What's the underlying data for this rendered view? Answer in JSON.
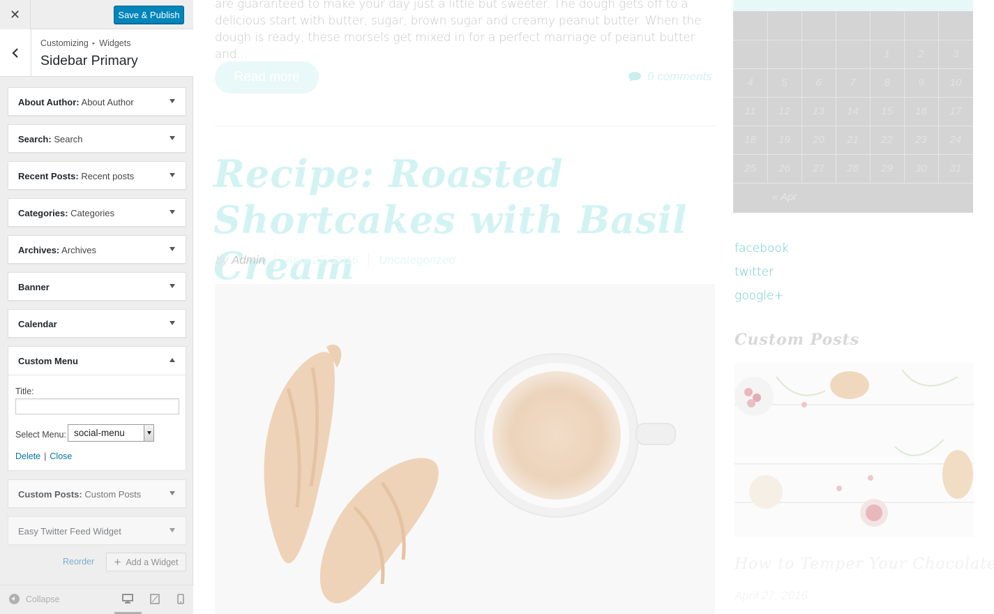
{
  "header": {
    "close_label": "✕",
    "publish_label": "Save & Publish"
  },
  "section": {
    "breadcrumb_root": "Customizing",
    "breadcrumb_sep": "▸",
    "breadcrumb_parent": "Widgets",
    "title": "Sidebar Primary"
  },
  "widgets": [
    {
      "type": "About Author",
      "title": "About Author"
    },
    {
      "type": "Search",
      "title": "Search"
    },
    {
      "type": "Recent Posts",
      "title": "Recent posts"
    },
    {
      "type": "Categories",
      "title": "Categories"
    },
    {
      "type": "Archives",
      "title": "Archives"
    },
    {
      "type": "Banner",
      "title": ""
    },
    {
      "type": "Calendar",
      "title": ""
    }
  ],
  "custom_menu": {
    "type": "Custom Menu",
    "title_label": "Title:",
    "title_value": "",
    "select_label": "Select Menu:",
    "select_value": "social-menu",
    "delete_label": "Delete",
    "link_sep": "|",
    "close_label": "Close"
  },
  "widgets_after": [
    {
      "type": "Custom Posts",
      "title": "Custom Posts"
    },
    {
      "type": "Easy Twitter Feed Widget",
      "title": ""
    }
  ],
  "panel_actions": {
    "reorder_label": "Reorder",
    "add_widget_label": "Add a Widget",
    "add_widget_icon": "plus-icon"
  },
  "footer": {
    "collapse_label": "Collapse",
    "devices": [
      "desktop-icon",
      "tablet-icon",
      "mobile-icon"
    ]
  },
  "preview": {
    "excerpt": "are guaranteed to make your day just a little but sweeter. The dough gets off to a delicious start with butter, sugar, brown sugar and creamy peanut butter. When the dough is ready, these morsels get mixed in for a perfect marriage of peanut butter and...",
    "read_more": "Read more",
    "comments": "0 comments",
    "post_title": "Recipe: Roasted Shortcakes with Basil Cream",
    "meta_by": "by",
    "meta_author": "Admin",
    "meta_date": "April 27, 2016",
    "meta_category": "Uncategorized",
    "calendar": {
      "days": [
        "",
        "",
        "",
        "",
        "1",
        "2",
        "3",
        "4",
        "5",
        "6",
        "7",
        "8",
        "9",
        "10",
        "11",
        "12",
        "13",
        "14",
        "15",
        "16",
        "17",
        "18",
        "19",
        "20",
        "21",
        "22",
        "23",
        "24",
        "25",
        "26",
        "27",
        "28",
        "29",
        "30",
        "31"
      ],
      "prev_label": "« Apr"
    },
    "social_links": [
      "facebook",
      "twitter",
      "google+"
    ],
    "custom_posts_heading": "Custom Posts",
    "custom_post_title": "How to Temper Your Chocolate",
    "custom_post_date": "April 27, 2016"
  },
  "colors": {
    "publish_blue": "#0085ba",
    "link_blue": "#0073aa",
    "preview_accent": "#67c8c8",
    "panel_bg": "#eeeeee"
  }
}
